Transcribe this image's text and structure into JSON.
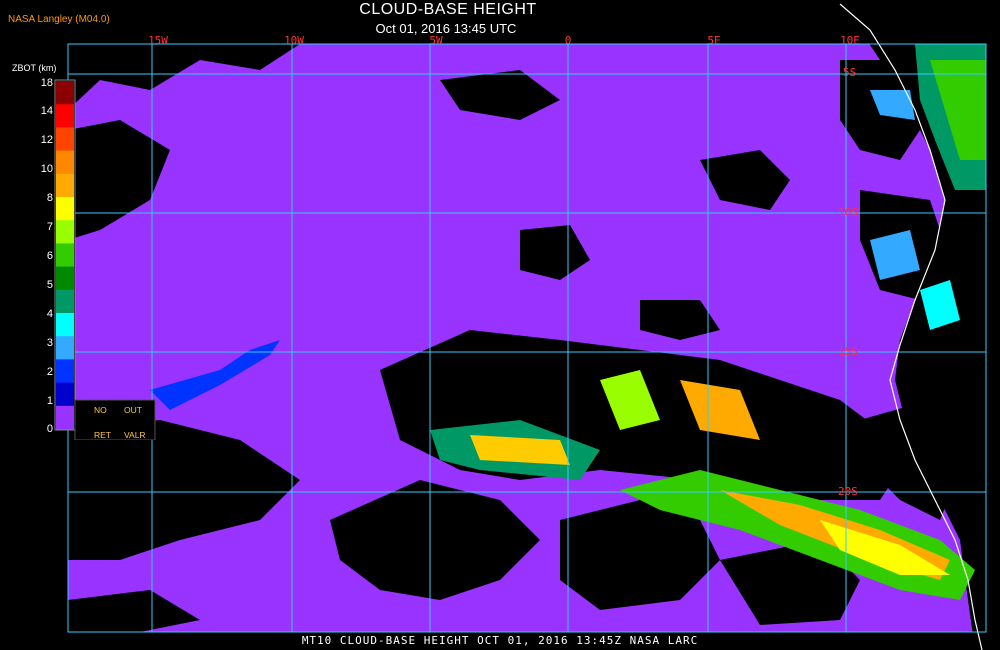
{
  "header": {
    "title": "CLOUD-BASE HEIGHT",
    "datetime": "Oct 01, 2016 13:45 UTC",
    "credit": "NASA Langley (M04.0)"
  },
  "footer": {
    "caption": "MT10  CLOUD-BASE HEIGHT   OCT 01, 2016 13:45Z   NASA LARC"
  },
  "map": {
    "lon_labels": [
      "15W",
      "10W",
      "5W",
      "0",
      "5E",
      "10E"
    ],
    "lat_labels": [
      "5S",
      "10S",
      "15S",
      "20S"
    ],
    "colors": {
      "ocean_cloud": "#9933ff",
      "clear": "#000000",
      "grid": "#33ccff",
      "coast": "#ffffff",
      "label": "#ff3333"
    }
  },
  "legend": {
    "title": "ZBOT (km)",
    "ticks": [
      "18",
      "14",
      "12",
      "10",
      "8",
      "7",
      "6",
      "5",
      "4",
      "3",
      "2",
      "1",
      "0"
    ],
    "colors": [
      "#8b0000",
      "#ff0000",
      "#ff4400",
      "#ff8800",
      "#ffaa00",
      "#ffff00",
      "#99ff00",
      "#33cc00",
      "#008800",
      "#009966",
      "#00ffff",
      "#33aaff",
      "#0033ff",
      "#0000cc",
      "#9933ff"
    ],
    "no_ret": [
      "NO",
      "RET"
    ],
    "out_valr": [
      "OUT",
      "VALR"
    ]
  }
}
